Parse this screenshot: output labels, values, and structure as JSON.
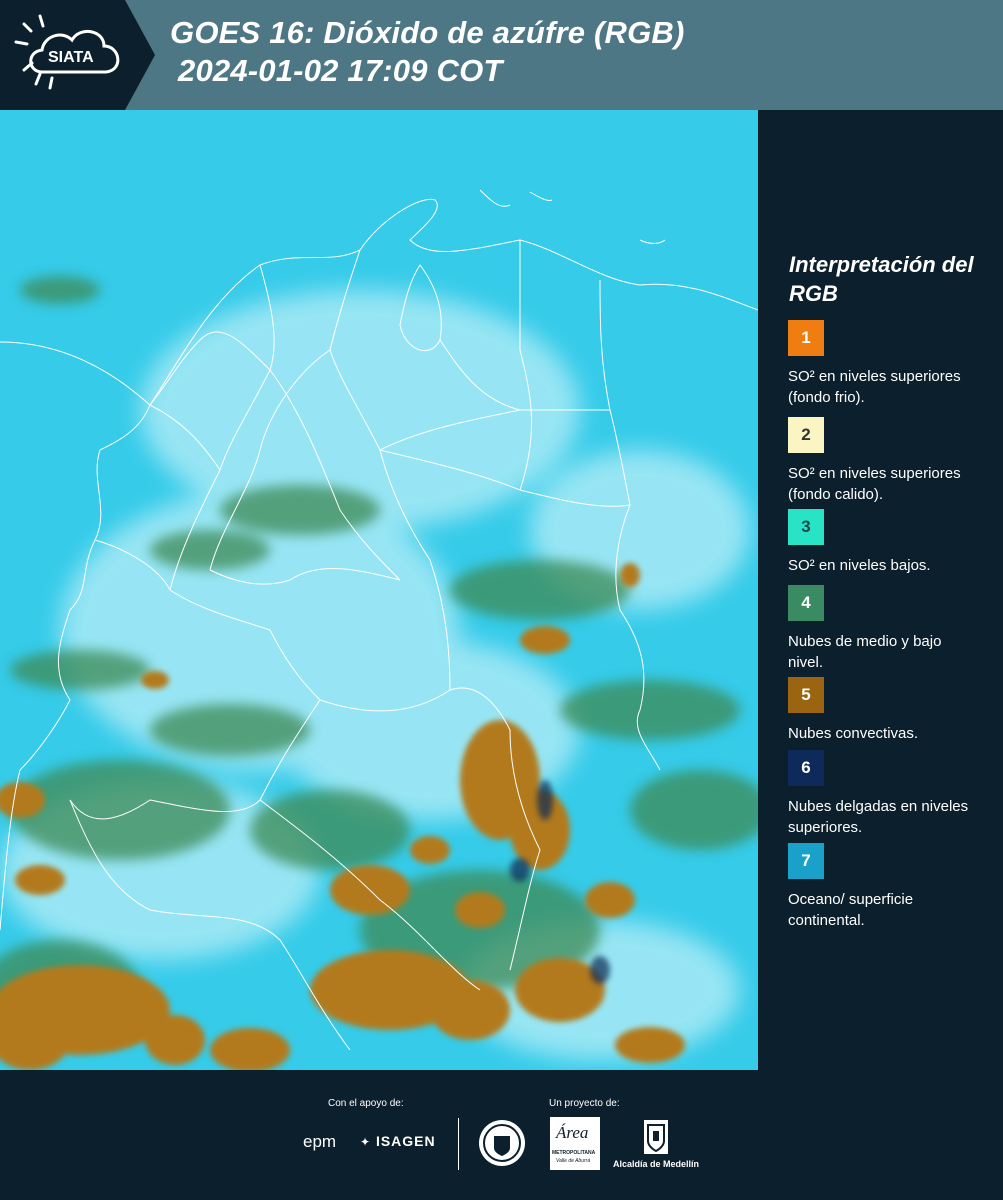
{
  "header": {
    "logo_text": "SIATA",
    "title_line1": "GOES 16: Dióxido de azúfre (RGB)",
    "title_line2": "2024-01-02 17:09 COT"
  },
  "map": {
    "background_color": "#33c9e8",
    "border_color": "#ffffff",
    "cloud_colors": {
      "light_cloud": "#9fe6f5",
      "mid_low_cloud": "#3f8a5a",
      "convective_cloud": "#b0791c",
      "thin_high_cloud": "#0f2a55"
    }
  },
  "legend": {
    "title": "Interpretación del RGB",
    "items": [
      {
        "number": "1",
        "color": "#f07d12",
        "text": "SO² en niveles superiores (fondo frio)."
      },
      {
        "number": "2",
        "color": "#fbf5c4",
        "text": "SO² en niveles superiores (fondo calido)."
      },
      {
        "number": "3",
        "color": "#29e3c6",
        "text": "SO² en niveles bajos."
      },
      {
        "number": "4",
        "color": "#3a8a62",
        "text": "Nubes de medio y bajo nivel."
      },
      {
        "number": "5",
        "color": "#9a6410",
        "text": "Nubes convectivas."
      },
      {
        "number": "6",
        "color": "#0e2a5a",
        "text": "Nubes delgadas en niveles superiores."
      },
      {
        "number": "7",
        "color": "#1aa1c9",
        "text": "Oceano/ superficie continental."
      }
    ]
  },
  "footer": {
    "support_label": "Con el apoyo de:",
    "project_label": "Un proyecto de:",
    "sponsor_epm": "epm",
    "sponsor_isagen": "ISAGEN",
    "partner_area_title": "Área",
    "partner_area_sub1": "METROPOLITANA",
    "partner_area_sub2": "Valle de Aburrá",
    "partner_alcaldia": "Alcaldía de Medellín"
  }
}
